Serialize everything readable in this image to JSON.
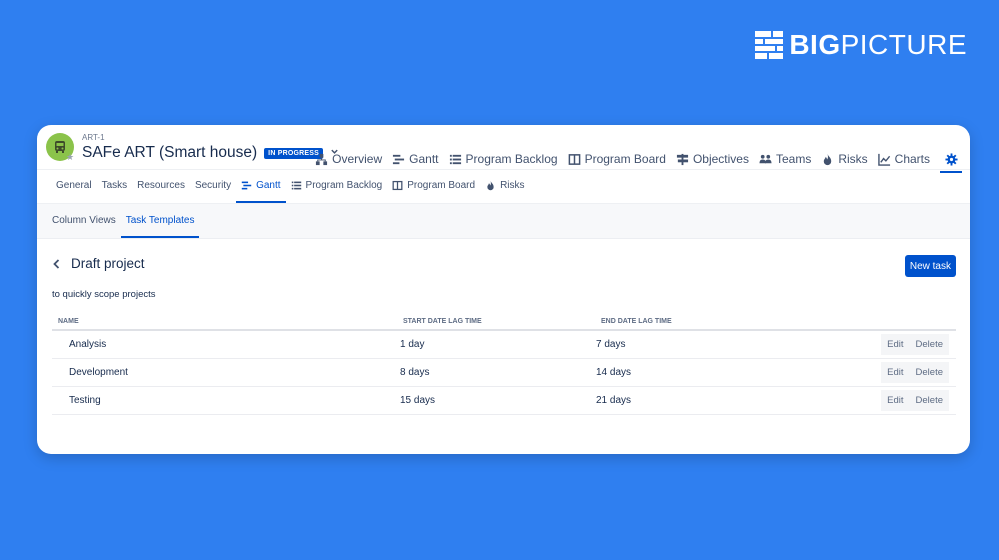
{
  "brand": {
    "bold": "BIG",
    "light": "PICTURE"
  },
  "header": {
    "issue_key": "ART-1",
    "title": "SAFe ART (Smart house)",
    "status": "IN PROGRESS"
  },
  "top_nav": [
    "Overview",
    "Gantt",
    "Program Backlog",
    "Program Board",
    "Objectives",
    "Teams",
    "Risks",
    "Charts"
  ],
  "sub_nav": [
    "General",
    "Tasks",
    "Resources",
    "Security",
    "Gantt",
    "Program Backlog",
    "Program Board",
    "Risks"
  ],
  "tabs": [
    "Column Views",
    "Task Templates"
  ],
  "page": {
    "title": "Draft project",
    "description": "to quickly scope projects",
    "new_task_label": "New task"
  },
  "table": {
    "headers": [
      "NAME",
      "START DATE LAG TIME",
      "END DATE LAG TIME"
    ],
    "rows": [
      {
        "name": "Analysis",
        "start": "1 day",
        "end": "7 days"
      },
      {
        "name": "Development",
        "start": "8 days",
        "end": "14 days"
      },
      {
        "name": "Testing",
        "start": "15 days",
        "end": "21 days"
      }
    ],
    "edit_label": "Edit",
    "delete_label": "Delete"
  },
  "colors": {
    "background": "#2f7ff0",
    "accent": "#0052cc",
    "avatar": "#8bc34a"
  }
}
